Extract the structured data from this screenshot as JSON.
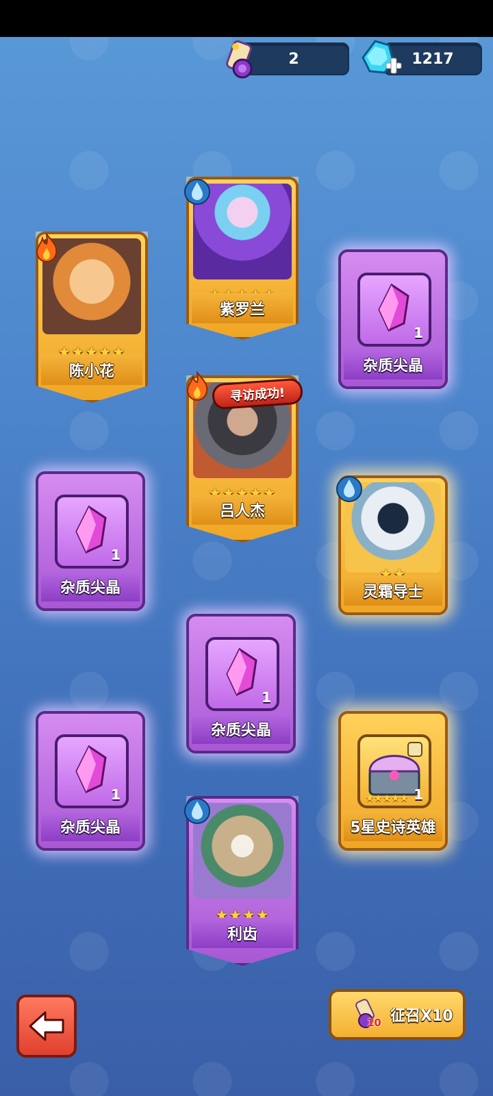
{
  "currency": {
    "scrolls": "2",
    "gems": "1217"
  },
  "cards": [
    {
      "name": "陈小花",
      "stars": "★★★★★",
      "element": "fire-icon",
      "type": "hero"
    },
    {
      "name": "紫罗兰",
      "stars": "★★★★★",
      "element": "water-icon",
      "type": "hero"
    },
    {
      "name": "杂质尖晶",
      "qty": "1",
      "type": "item"
    },
    {
      "name": "吕人杰",
      "stars": "★★★★★",
      "element": "fire-icon",
      "type": "hero",
      "banner": "寻访成功!"
    },
    {
      "name": "杂质尖晶",
      "qty": "1",
      "type": "item"
    },
    {
      "name": "灵霜导士",
      "stars": "★★",
      "element": "water-icon",
      "type": "hero"
    },
    {
      "name": "杂质尖晶",
      "qty": "1",
      "type": "item"
    },
    {
      "name": "杂质尖晶",
      "qty": "1",
      "type": "item"
    },
    {
      "name": "5星史诗英雄",
      "stars": "★★★★★",
      "qty": "1",
      "type": "chest"
    },
    {
      "name": "利齿",
      "stars": "★★★★",
      "element": "water-icon",
      "type": "hero"
    }
  ],
  "buttons": {
    "summon_label": "征召X10",
    "summon_count": "10"
  },
  "colors": {
    "gold_card": "#f0a626",
    "purple_card": "#a858d4",
    "background": "#4d86cc"
  }
}
